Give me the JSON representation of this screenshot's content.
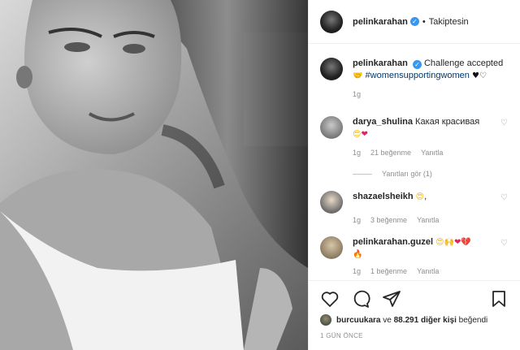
{
  "post": {
    "author": "pelinkarahan",
    "follow_status": "Takiptesin",
    "separator": "•",
    "caption_text": "Challenge accepted",
    "caption_hashtag": "#womensupportingwomen",
    "caption_time": "1g"
  },
  "comments": [
    {
      "user": "darya_shulina",
      "text": "Какая красивая",
      "emoji": "😍❤️",
      "time": "1g",
      "likes": "21 beğenme",
      "reply": "Yanıtla"
    },
    {
      "user": "shazaelsheikh",
      "text": ",",
      "emoji": "😍",
      "time": "1g",
      "likes": "3 beğenme",
      "reply": "Yanıtla"
    },
    {
      "user": "pelinkarahan.guzel",
      "text": "",
      "emoji": "😍🙌❤️💔🔥",
      "time": "1g",
      "likes": "1 beğenme",
      "reply": "Yanıtla"
    }
  ],
  "view_replies": "Yanıtları gör (1)",
  "likes_line": {
    "user": "burcuukara",
    "middle": " ve ",
    "count": "88.291 diğer kişi",
    "end": " beğendi"
  },
  "date": "1 GÜN ÖNCE",
  "colors": {
    "link": "#00376b",
    "muted": "#8e8e8e",
    "verified": "#3897f0",
    "like_red": "#e0245e"
  },
  "icons": [
    "heart-icon",
    "comment-icon",
    "share-icon",
    "bookmark-icon",
    "verified-badge-icon",
    "small-heart-icon"
  ]
}
